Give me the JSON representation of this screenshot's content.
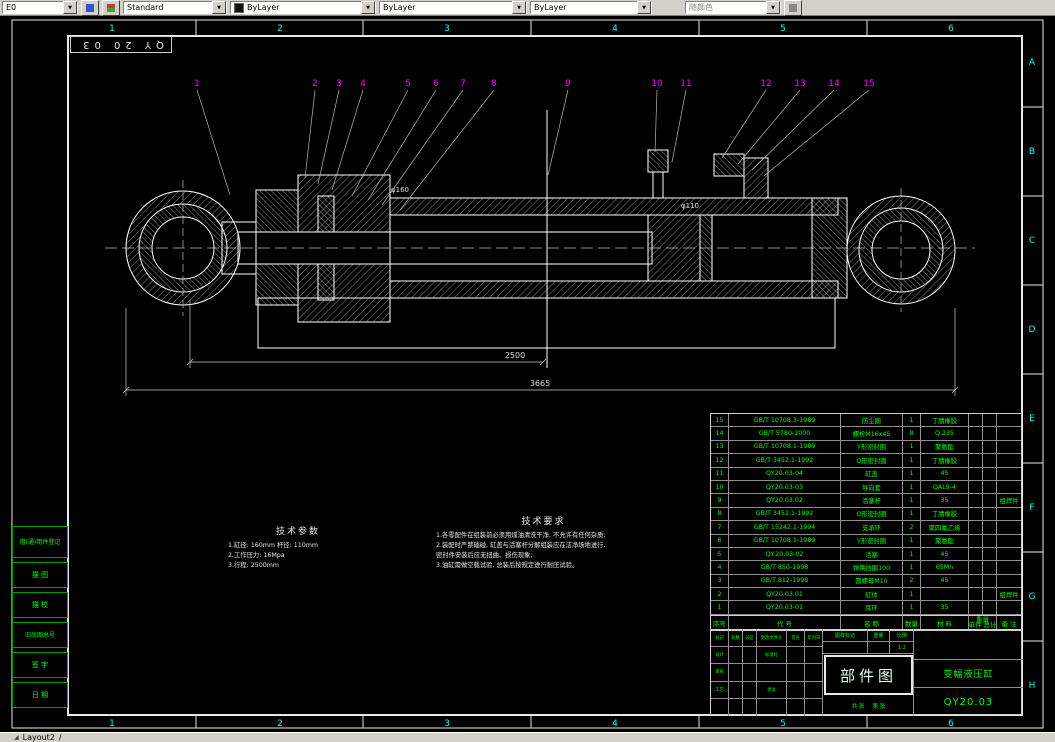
{
  "colors": {
    "green": "#00ff00",
    "cyan": "#00ffff",
    "magenta": "#ff00ff",
    "paper_line": "#ffffff"
  },
  "toolbar": {
    "layer": "E0",
    "style": "Standard",
    "color": "ByLayer",
    "linetype": "ByLayer",
    "lineweight": "ByLayer",
    "plotstyle": "随颜色"
  },
  "sheet": {
    "zones_top": [
      "1",
      "2",
      "3",
      "4",
      "5",
      "6"
    ],
    "zones_bottom": [
      "1",
      "2",
      "3",
      "4",
      "5",
      "6"
    ],
    "zones_right": [
      "A",
      "B",
      "C",
      "D",
      "E",
      "F",
      "G",
      "H"
    ],
    "stamp": "QY 20 03",
    "margin_labels": [
      "借(通)用件登记",
      "描 图",
      "描 校",
      "旧底图总号",
      "签 字",
      "日 期"
    ]
  },
  "callouts": [
    "1",
    "2",
    "3",
    "4",
    "5",
    "6",
    "7",
    "8",
    "9",
    "10",
    "11",
    "12",
    "13",
    "14",
    "15"
  ],
  "dimensions": {
    "stroke": "2500",
    "overall": "3665",
    "bore": "φ160",
    "rod": "φ110"
  },
  "tech_params": {
    "title": "技术参数",
    "lines": [
      "1.缸径: 160mm  杆径: 110mm",
      "2.工作压力: 16Mpa",
      "3.行程: 2500mm"
    ]
  },
  "tech_req": {
    "title": "技术要求",
    "lines": [
      "1.各零配件在组装前必须用煤油清洗干净, 不允许有任何杂质;",
      "2.装配时严禁磕碰, 缸盖与活塞杆分解组装应在洁净场地进行,",
      "   密封件安装后应无扭曲、损伤现象;",
      "3.油缸需做空载试验, 总装后按规定进行耐压试验。"
    ]
  },
  "bom": {
    "headers": {
      "no": "序号",
      "code": "代  号",
      "name": "名  称",
      "qty": "数量",
      "material": "材  料",
      "weight": "重量",
      "unit": "单件",
      "total": "总计",
      "remark": "备 注"
    },
    "rows": [
      {
        "no": "15",
        "code": "GB/T 10708.3-1989",
        "name": "防尘圈",
        "qty": "1",
        "material": "丁腈橡胶",
        "remark": ""
      },
      {
        "no": "14",
        "code": "GB/T 5780-2000",
        "name": "螺栓M16x45",
        "qty": "8",
        "material": "Q.235",
        "remark": ""
      },
      {
        "no": "13",
        "code": "GB/T 10708.1-1989",
        "name": "Y形密封圈",
        "qty": "1",
        "material": "聚氨酯",
        "remark": ""
      },
      {
        "no": "12",
        "code": "GB/T 3452.1-1992",
        "name": "O形密封圈",
        "qty": "1",
        "material": "丁腈橡胶",
        "remark": ""
      },
      {
        "no": "11",
        "code": "QY20.03-04",
        "name": "缸盖",
        "qty": "1",
        "material": "45",
        "remark": ""
      },
      {
        "no": "10",
        "code": "QY20.03-03",
        "name": "导向套",
        "qty": "1",
        "material": "QAL9-4",
        "remark": ""
      },
      {
        "no": "9",
        "code": "QY20.03.02",
        "name": "活塞杆",
        "qty": "1",
        "material": "35",
        "remark": "组焊件"
      },
      {
        "no": "8",
        "code": "GB/T 3452.1-1992",
        "name": "O形密封圈",
        "qty": "1",
        "material": "丁腈橡胶",
        "remark": ""
      },
      {
        "no": "7",
        "code": "GB/T 15242.1-1994",
        "name": "支承环",
        "qty": "2",
        "material": "聚四氟乙烯",
        "remark": ""
      },
      {
        "no": "6",
        "code": "GB/T 10708.1-1989",
        "name": "Y形密封圈",
        "qty": "1",
        "material": "聚氨酯",
        "remark": ""
      },
      {
        "no": "5",
        "code": "QY.20.03-02",
        "name": "活塞",
        "qty": "1",
        "material": "45",
        "remark": ""
      },
      {
        "no": "4",
        "code": "GB/T 850-1998",
        "name": "弹簧挡圈100",
        "qty": "1",
        "material": "65Mn",
        "remark": ""
      },
      {
        "no": "3",
        "code": "GB/T 812-1998",
        "name": "圆螺母M10",
        "qty": "2",
        "material": "45",
        "remark": ""
      },
      {
        "no": "2",
        "code": "QY20.03.01",
        "name": "缸体",
        "qty": "1",
        "material": "",
        "remark": "组焊件"
      },
      {
        "no": "1",
        "code": "QY20.03-01",
        "name": "耳环",
        "qty": "1",
        "material": "35",
        "remark": ""
      }
    ]
  },
  "titleblock": {
    "doc_type": "部件图",
    "product_name": "变幅液压缸",
    "drawing_no": "QY20.03",
    "mark_label": "图样标记",
    "weight_label": "重量",
    "scale_label": "比例",
    "scale_value": "1:2",
    "sheet_total": "共 张",
    "sheet_no": "第 张",
    "sign_head": [
      "标记",
      "处数",
      "分区",
      "更改文件号",
      "签名",
      "年月日"
    ],
    "design_label": "设计",
    "std_label": "标准化",
    "audit_label": "审核",
    "process_label": "工艺",
    "approve_label": "批准"
  },
  "statusbar": {
    "tab": "Layout2"
  }
}
